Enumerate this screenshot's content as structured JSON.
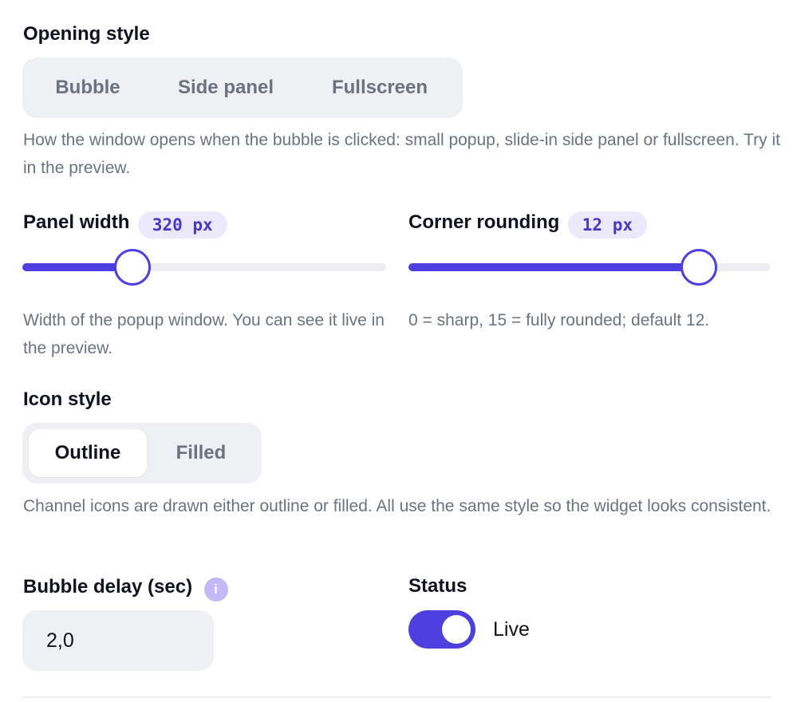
{
  "opening_style": {
    "label": "Opening style",
    "options": [
      "Bubble",
      "Side panel",
      "Fullscreen"
    ],
    "help": "How the window opens when the bubble is clicked: small popup, slide-in side panel or fullscreen. Try it in the preview."
  },
  "panel_width": {
    "label": "Panel width",
    "value_text": "320 px",
    "slider_fraction": 0.3,
    "help": "Width of the popup window. You can see it live in the preview."
  },
  "corner_rounding": {
    "label": "Corner rounding",
    "value_text": "12 px",
    "value": 12,
    "min": 0,
    "max": 15,
    "help": "0 = sharp, 15 = fully rounded; default 12."
  },
  "icon_style": {
    "label": "Icon style",
    "options": [
      "Outline",
      "Filled"
    ],
    "selected": "Outline",
    "help": "Channel icons are drawn either outline or filled. All use the same style so the widget looks consistent."
  },
  "bubble_delay": {
    "label": "Bubble delay (sec)",
    "info_glyph": "i",
    "value": "2,0"
  },
  "status": {
    "label": "Status",
    "toggle_on": true,
    "toggle_label": "Live"
  },
  "colors": {
    "accent": "#4d3fe0",
    "pill_bg": "#ece9fd",
    "info_icon": "#c4b8f7"
  }
}
